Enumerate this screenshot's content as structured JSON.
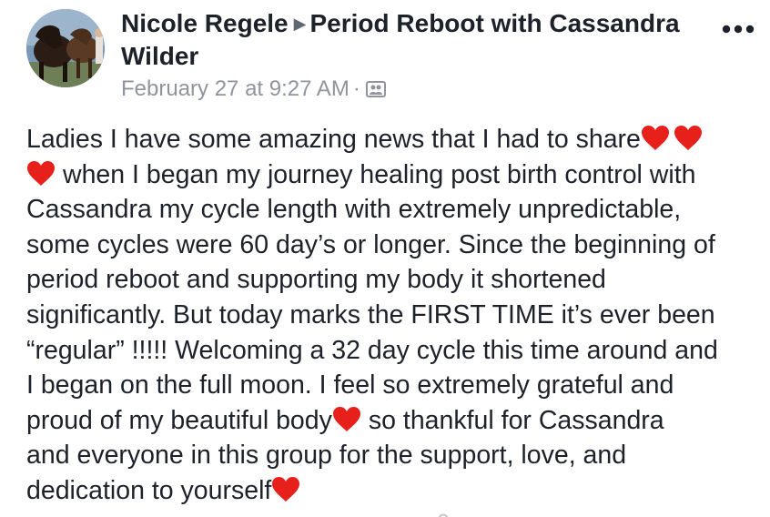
{
  "post": {
    "author_name": "Nicole Regele",
    "group_name": "Period Reboot with Cassandra Wilder",
    "timestamp": "February 27 at 9:27 AM",
    "separator": "·",
    "privacy_icon": "group-members-icon",
    "more_icon": "more-options-icon",
    "heart_color": "#e8201c",
    "body_lines": [
      {
        "segments": [
          "Ladies I have some amazing news that I had to share"
        ],
        "hearts_after": 2
      },
      {
        "hearts_before": 1,
        "segments": [
          "when I began my journey healing post birth control with"
        ]
      },
      {
        "segments": [
          "Cassandra my cycle length with extremely unpredictable,"
        ]
      },
      {
        "segments": [
          "some cycles were 60 day’s or longer. Since the beginning of"
        ]
      },
      {
        "segments": [
          "period reboot and supporting my body it shortened"
        ]
      },
      {
        "segments": [
          "significantly. But today marks the FIRST TIME it’s ever been"
        ]
      },
      {
        "segments": [
          "“regular” !!!!! Welcoming a 32 day cycle this time around and"
        ]
      },
      {
        "segments": [
          "I began on the full moon. I feel so extremely grateful and"
        ]
      },
      {
        "segments": [
          "proud of my beautiful body",
          "so thankful for Cassandra"
        ],
        "heart_between": true
      },
      {
        "segments": [
          "and everyone in this group for the support, love, and"
        ]
      },
      {
        "segments": [
          "dedication to yourself"
        ],
        "hearts_after": 1
      }
    ]
  }
}
